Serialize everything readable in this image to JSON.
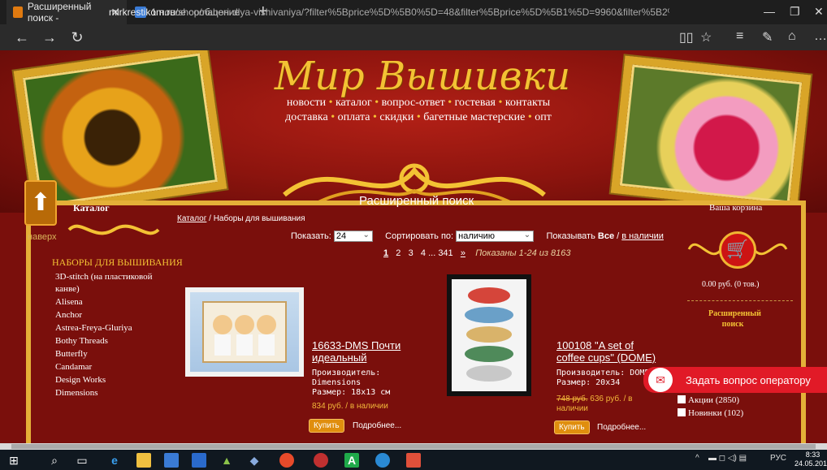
{
  "browser": {
    "tabs": [
      {
        "label": "Расширенный поиск -",
        "active": true
      },
      {
        "label": "1 новое сообщение",
        "active": false
      }
    ],
    "url_host": "mirkrestikom.ru",
    "url_path": "/shop/nabori-dlya-vishivaniya/?filter%5Bprice%5D%5B0%5D=48&filter%5Bprice%5D%5B1%5D=9960&filter%5B2%5D%5Bвышивка+крестом%"
  },
  "site": {
    "logo": "Мир Вышивки",
    "menu_row1": [
      "новости",
      "каталог",
      "вопрос-ответ",
      "гостевая",
      "контакты"
    ],
    "menu_row2": [
      "доставка",
      "оплата",
      "скидки",
      "багетные мастерские",
      "опт"
    ],
    "up_label": "наверх"
  },
  "left": {
    "catalog_title": "Каталог",
    "section_head": "НАБОРЫ ДЛЯ ВЫШИВАНИЯ",
    "items": [
      "3D-stitch (на пластиковой канве)",
      "Alisena",
      "Anchor",
      "Astrea-Freya-Gluriya",
      "Bothy Threads",
      "Butterfly",
      "Candamar",
      "Design Works",
      "Dimensions"
    ]
  },
  "main": {
    "title": "Расширенный поиск",
    "breadcrumb_link": "Каталог",
    "breadcrumb_rest": " / Наборы для вышивания",
    "show_label": "Показать:",
    "show_value": "24",
    "sort_label": "Сортировать по:",
    "sort_value": "наличию",
    "display_label": "Показывать",
    "display_all": "Все",
    "display_sep": " / ",
    "display_stock": "в наличии",
    "pages": [
      "1",
      "2",
      "3",
      "4",
      "...",
      "341",
      "»"
    ],
    "shown": "Показаны 1-24 из 8163"
  },
  "products": [
    {
      "title_line1": "16633-DMS Почти",
      "title_line2": "идеальный",
      "maker_label": "Производитель:",
      "maker": "Dimensions",
      "size": "Размер: 18x13 см",
      "old_price": "",
      "price": "834 руб. / в наличии",
      "price_line2": "",
      "buy": "Купить",
      "more": "Подробнее..."
    },
    {
      "title_line1": "100108 \"A set of",
      "title_line2": "coffee cups\" (DOME)",
      "maker_label": "Производитель: DOME",
      "maker": "",
      "size": "Размер: 20x34",
      "old_price": "748 руб.",
      "price": " 636 руб. / в",
      "price_line2": "наличии",
      "buy": "Купить",
      "more": "Подробнее..."
    }
  ],
  "right": {
    "cart_title": "Ваша корзина",
    "cart_sum": "0.00 руб.  (0 тов.)",
    "adv_search": "Расширенный поиск",
    "filters": [
      "Акции (2850)",
      "Новинки (102)"
    ]
  },
  "operator": {
    "label": "Задать вопрос оператору"
  },
  "taskbar": {
    "lang": "РУС",
    "time": "8:33",
    "date": "24.05.2016"
  },
  "colors": {
    "page_bg": "#7a0f0c",
    "gold": "#f3c234",
    "operator_red": "#e11a27"
  }
}
